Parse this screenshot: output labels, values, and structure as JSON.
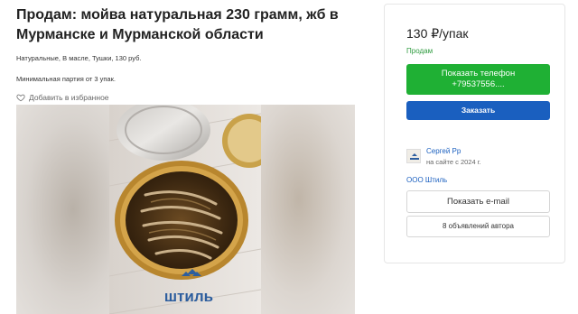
{
  "listing": {
    "title": "Продам: мойва натуральная 230 грамм, жб в Мурманске и Мурманской области",
    "tags": "Натуральные, В масле, Тушки, 130 руб.",
    "min_lot": "Минимальная партия от 3 упак.",
    "favorite_label": "Добавить в избранное",
    "photo_brand": "штиль"
  },
  "sidebar": {
    "price": "130 ₽/упак",
    "status": "Продам",
    "phone_line1": "Показать телефон",
    "phone_line2": "+79537556....",
    "order_label": "Заказать",
    "seller_name": "Сергей Рр",
    "seller_since": "на сайте с 2024 г.",
    "company": "ООО Штиль",
    "email_label": "Показать e-mail",
    "ads_label": "8 объявлений автора"
  },
  "colors": {
    "green": "#1fb034",
    "blue": "#1a5fbf",
    "status_green": "#2e9b3f"
  }
}
